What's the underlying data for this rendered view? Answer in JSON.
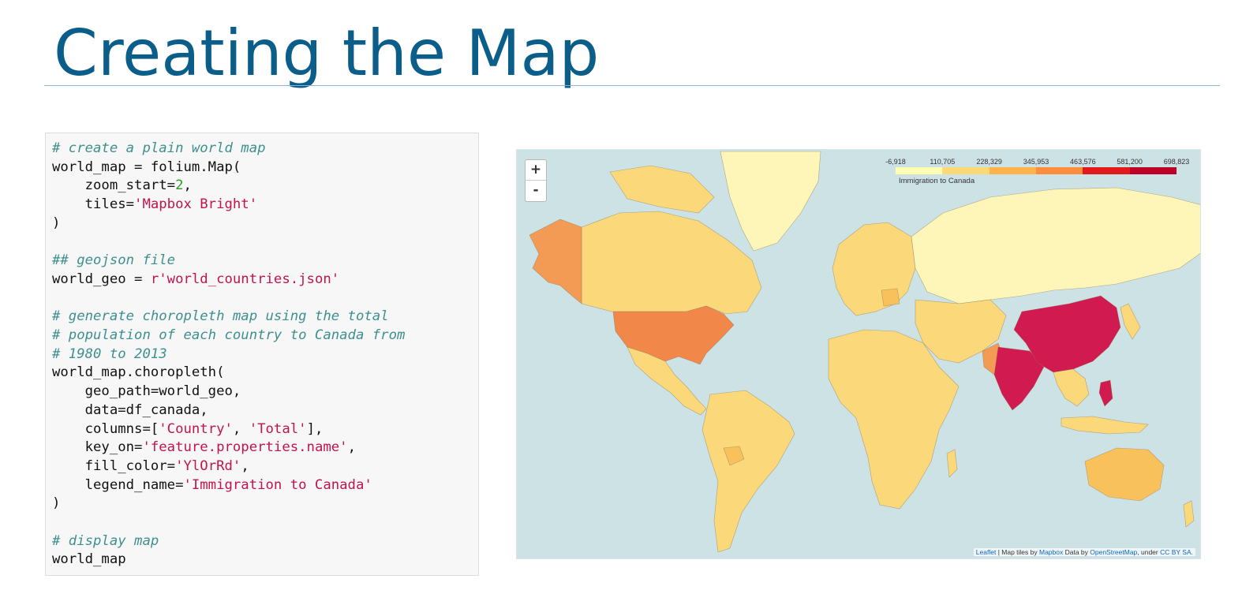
{
  "slide": {
    "title": "Creating the Map"
  },
  "code_lines": [
    [
      [
        "c",
        "# create a plain world map"
      ]
    ],
    [
      [
        "t",
        "world_map = folium.Map("
      ]
    ],
    [
      [
        "t",
        "    zoom_start="
      ],
      [
        "n",
        "2"
      ],
      [
        "t",
        ","
      ]
    ],
    [
      [
        "t",
        "    tiles="
      ],
      [
        "s",
        "'Mapbox Bright'"
      ]
    ],
    [
      [
        "t",
        ")"
      ]
    ],
    [],
    [
      [
        "c",
        "## geojson file"
      ]
    ],
    [
      [
        "t",
        "world_geo = "
      ],
      [
        "s",
        "r'world_countries.json'"
      ]
    ],
    [],
    [
      [
        "c",
        "# generate choropleth map using the total"
      ]
    ],
    [
      [
        "c",
        "# population of each country to Canada from"
      ]
    ],
    [
      [
        "c",
        "# 1980 to 2013"
      ]
    ],
    [
      [
        "t",
        "world_map.choropleth("
      ]
    ],
    [
      [
        "t",
        "    geo_path=world_geo,"
      ]
    ],
    [
      [
        "t",
        "    data=df_canada,"
      ]
    ],
    [
      [
        "t",
        "    columns=["
      ],
      [
        "s",
        "'Country'"
      ],
      [
        "t",
        ", "
      ],
      [
        "s",
        "'Total'"
      ],
      [
        "t",
        "],"
      ]
    ],
    [
      [
        "t",
        "    key_on="
      ],
      [
        "s",
        "'feature.properties.name'"
      ],
      [
        "t",
        ","
      ]
    ],
    [
      [
        "t",
        "    fill_color="
      ],
      [
        "s",
        "'YlOrRd'"
      ],
      [
        "t",
        ","
      ]
    ],
    [
      [
        "t",
        "    legend_name="
      ],
      [
        "s",
        "'Immigration to Canada'"
      ]
    ],
    [
      [
        "t",
        ")"
      ]
    ],
    [],
    [
      [
        "c",
        "# display map"
      ]
    ],
    [
      [
        "t",
        "world_map"
      ]
    ]
  ],
  "map": {
    "zoom_in_label": "+",
    "zoom_out_label": "-",
    "legend": {
      "ticks": [
        "-6,918",
        "110,705",
        "228,329",
        "345,953",
        "463,576",
        "581,200",
        "698,823"
      ],
      "colors": [
        "#ffffb2",
        "#fed976",
        "#feb24c",
        "#fd8d3c",
        "#e31a1c",
        "#bd0026"
      ],
      "caption": "Immigration to Canada"
    },
    "attribution": {
      "leaflet": "Leaflet",
      "text1": " | Map tiles by ",
      "mapbox": "Mapbox",
      "text2": " Data by ",
      "osm": "OpenStreetMap",
      "text3": ", under ",
      "license": "CC BY SA."
    },
    "palette": {
      "water": "#cde2e4",
      "low": "#fef6b8",
      "light": "#fbd87a",
      "mid": "#f9c15c",
      "orange": "#f39a55",
      "darkorange": "#f2874a",
      "red": "#d11a4f",
      "border": "#8a7a55"
    }
  }
}
